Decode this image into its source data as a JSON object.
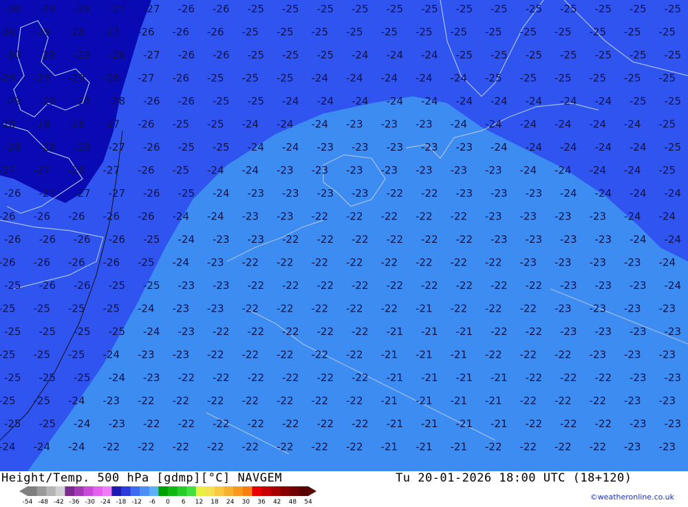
{
  "footer": {
    "title": "Height/Temp. 500 hPa [gdmp][°C] NAVGEM",
    "datetime": "Tu 20-01-2026 18:00 UTC (18+120)",
    "credit": "©weatheronline.co.uk"
  },
  "legend": {
    "ticks": [
      "-54",
      "-48",
      "-42",
      "-36",
      "-30",
      "-24",
      "-18",
      "-12",
      "-6",
      "0",
      "6",
      "12",
      "18",
      "24",
      "30",
      "36",
      "42",
      "48",
      "54"
    ],
    "colors": [
      "#7f7f7f",
      "#9a9a9a",
      "#b4b4b4",
      "#d0d0d0",
      "#7b2b8f",
      "#a33ab5",
      "#c94ad6",
      "#e45ef0",
      "#f07cf5",
      "#1a1ab0",
      "#2c3cd8",
      "#3d6cf0",
      "#4b8ff5",
      "#5cb0f8",
      "#00a000",
      "#10b810",
      "#28cc28",
      "#40e040",
      "#e8f040",
      "#f4e050",
      "#f8c840",
      "#f8b030",
      "#f89820",
      "#f88010",
      "#e80000",
      "#c80000",
      "#a80000",
      "#880000",
      "#700000",
      "#580000"
    ]
  },
  "map": {
    "colors": {
      "band_minus28": "#0a0ab4",
      "band_minus24": "#2f54f0",
      "band_minus20": "#3c8cf2",
      "isoline_label": "#10124a",
      "coast": "#a8c0e8"
    },
    "labels": [
      {
        "r": 0,
        "vals": [
          "-30",
          "-29",
          "-28",
          "-27",
          "-27",
          "-26",
          "-26",
          "-25",
          "-25",
          "-25",
          "-25",
          "-25",
          "-25",
          "-25",
          "-25",
          "-25",
          "-25",
          "-25",
          "-25",
          "-25"
        ]
      },
      {
        "r": 1,
        "vals": [
          "-30",
          "-29",
          "-28",
          "-27",
          "-26",
          "-26",
          "-26",
          "-25",
          "-25",
          "-25",
          "-25",
          "-25",
          "-25",
          "-25",
          "-25",
          "-25",
          "-25",
          "-25",
          "-25",
          "-25"
        ]
      },
      {
        "r": 2,
        "vals": [
          "-30",
          "-29",
          "-29",
          "-28",
          "-27",
          "-26",
          "-26",
          "-25",
          "-25",
          "-25",
          "-24",
          "-24",
          "-24",
          "-25",
          "-25",
          "-25",
          "-25",
          "-25",
          "-25",
          "-25"
        ]
      },
      {
        "r": 3,
        "vals": [
          "-29",
          "-29",
          "-29",
          "-28",
          "-27",
          "-26",
          "-25",
          "-25",
          "-25",
          "-24",
          "-24",
          "-24",
          "-24",
          "-24",
          "-25",
          "-25",
          "-25",
          "-25",
          "-25",
          "-25"
        ]
      },
      {
        "r": 4,
        "vals": [
          "-29",
          "-29",
          "-29",
          "-28",
          "-26",
          "-26",
          "-25",
          "-25",
          "-24",
          "-24",
          "-24",
          "-24",
          "-24",
          "-24",
          "-24",
          "-24",
          "-24",
          "-24",
          "-25",
          "-25"
        ]
      },
      {
        "r": 5,
        "vals": [
          "-28",
          "-28",
          "-28",
          "-27",
          "-26",
          "-25",
          "-25",
          "-24",
          "-24",
          "-24",
          "-23",
          "-23",
          "-23",
          "-24",
          "-24",
          "-24",
          "-24",
          "-24",
          "-24",
          "-25"
        ]
      },
      {
        "r": 6,
        "vals": [
          "-28",
          "-28",
          "-28",
          "-27",
          "-26",
          "-25",
          "-25",
          "-24",
          "-24",
          "-23",
          "-23",
          "-23",
          "-23",
          "-23",
          "-24",
          "-24",
          "-24",
          "-24",
          "-24",
          "-25"
        ]
      },
      {
        "r": 7,
        "vals": [
          "-27",
          "-27",
          "-28",
          "-27",
          "-26",
          "-25",
          "-24",
          "-24",
          "-23",
          "-23",
          "-23",
          "-23",
          "-23",
          "-23",
          "-23",
          "-24",
          "-24",
          "-24",
          "-24",
          "-25"
        ]
      },
      {
        "r": 8,
        "vals": [
          "-26",
          "-27",
          "-27",
          "-27",
          "-26",
          "-25",
          "-24",
          "-23",
          "-23",
          "-23",
          "-23",
          "-22",
          "-22",
          "-23",
          "-23",
          "-23",
          "-24",
          "-24",
          "-24",
          "-24"
        ]
      },
      {
        "r": 9,
        "vals": [
          "-26",
          "-26",
          "-26",
          "-26",
          "-26",
          "-24",
          "-24",
          "-23",
          "-23",
          "-22",
          "-22",
          "-22",
          "-22",
          "-22",
          "-23",
          "-23",
          "-23",
          "-23",
          "-24",
          "-24"
        ]
      },
      {
        "r": 10,
        "vals": [
          "-26",
          "-26",
          "-26",
          "-26",
          "-25",
          "-24",
          "-23",
          "-23",
          "-22",
          "-22",
          "-22",
          "-22",
          "-22",
          "-22",
          "-23",
          "-23",
          "-23",
          "-23",
          "-24",
          "-24"
        ]
      },
      {
        "r": 11,
        "vals": [
          "-26",
          "-26",
          "-26",
          "-26",
          "-25",
          "-24",
          "-23",
          "-22",
          "-22",
          "-22",
          "-22",
          "-22",
          "-22",
          "-22",
          "-22",
          "-23",
          "-23",
          "-23",
          "-23",
          "-24"
        ]
      },
      {
        "r": 12,
        "vals": [
          "-25",
          "-26",
          "-26",
          "-25",
          "-25",
          "-23",
          "-23",
          "-22",
          "-22",
          "-22",
          "-22",
          "-22",
          "-22",
          "-22",
          "-22",
          "-22",
          "-23",
          "-23",
          "-23",
          "-24"
        ]
      },
      {
        "r": 13,
        "vals": [
          "-25",
          "-25",
          "-25",
          "-25",
          "-24",
          "-23",
          "-23",
          "-22",
          "-22",
          "-22",
          "-22",
          "-22",
          "-21",
          "-22",
          "-22",
          "-22",
          "-23",
          "-23",
          "-23",
          "-23"
        ]
      },
      {
        "r": 14,
        "vals": [
          "-25",
          "-25",
          "-25",
          "-25",
          "-24",
          "-23",
          "-22",
          "-22",
          "-22",
          "-22",
          "-22",
          "-21",
          "-21",
          "-21",
          "-22",
          "-22",
          "-23",
          "-23",
          "-23",
          "-23"
        ]
      },
      {
        "r": 15,
        "vals": [
          "-25",
          "-25",
          "-25",
          "-24",
          "-23",
          "-23",
          "-22",
          "-22",
          "-22",
          "-22",
          "-22",
          "-21",
          "-21",
          "-21",
          "-22",
          "-22",
          "-22",
          "-23",
          "-23",
          "-23"
        ]
      },
      {
        "r": 16,
        "vals": [
          "-25",
          "-25",
          "-25",
          "-24",
          "-23",
          "-22",
          "-22",
          "-22",
          "-22",
          "-22",
          "-22",
          "-21",
          "-21",
          "-21",
          "-21",
          "-22",
          "-22",
          "-22",
          "-23",
          "-23"
        ]
      },
      {
        "r": 17,
        "vals": [
          "-25",
          "-25",
          "-24",
          "-23",
          "-22",
          "-22",
          "-22",
          "-22",
          "-22",
          "-22",
          "-22",
          "-21",
          "-21",
          "-21",
          "-21",
          "-22",
          "-22",
          "-22",
          "-23",
          "-23"
        ]
      },
      {
        "r": 18,
        "vals": [
          "-25",
          "-25",
          "-24",
          "-23",
          "-22",
          "-22",
          "-22",
          "-22",
          "-22",
          "-22",
          "-22",
          "-21",
          "-21",
          "-21",
          "-21",
          "-22",
          "-22",
          "-22",
          "-23",
          "-23"
        ]
      },
      {
        "r": 19,
        "vals": [
          "-24",
          "-24",
          "-24",
          "-22",
          "-22",
          "-22",
          "-22",
          "-22",
          "-22",
          "-22",
          "-22",
          "-21",
          "-21",
          "-21",
          "-22",
          "-22",
          "-22",
          "-22",
          "-23",
          "-23"
        ]
      }
    ]
  }
}
